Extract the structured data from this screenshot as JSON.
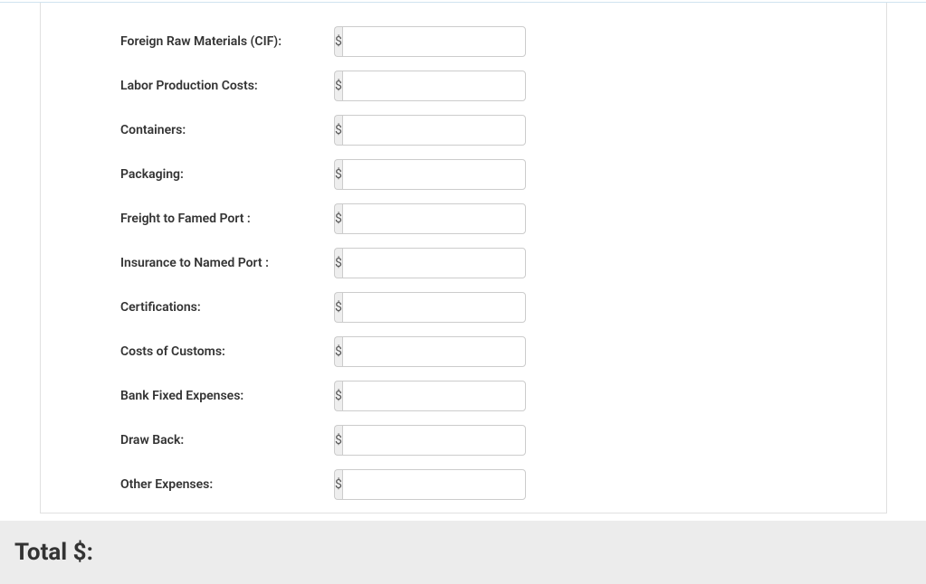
{
  "form": {
    "currency_symbol": "$",
    "fields": [
      {
        "label": "Foreign Raw Materials (CIF):",
        "name": "foreign-raw-materials",
        "value": ""
      },
      {
        "label": "Labor Production Costs:",
        "name": "labor-production-costs",
        "value": ""
      },
      {
        "label": "Containers:",
        "name": "containers",
        "value": ""
      },
      {
        "label": "Packaging:",
        "name": "packaging",
        "value": ""
      },
      {
        "label": "Freight to Famed Port :",
        "name": "freight-to-famed-port",
        "value": ""
      },
      {
        "label": "Insurance to Named Port :",
        "name": "insurance-to-named-port",
        "value": ""
      },
      {
        "label": "Certifications:",
        "name": "certifications",
        "value": ""
      },
      {
        "label": "Costs of Customs:",
        "name": "costs-of-customs",
        "value": ""
      },
      {
        "label": "Bank Fixed Expenses:",
        "name": "bank-fixed-expenses",
        "value": ""
      },
      {
        "label": "Draw Back:",
        "name": "draw-back",
        "value": ""
      },
      {
        "label": "Other Expenses:",
        "name": "other-expenses",
        "value": ""
      }
    ]
  },
  "total": {
    "label": "Total $:",
    "value": ""
  }
}
